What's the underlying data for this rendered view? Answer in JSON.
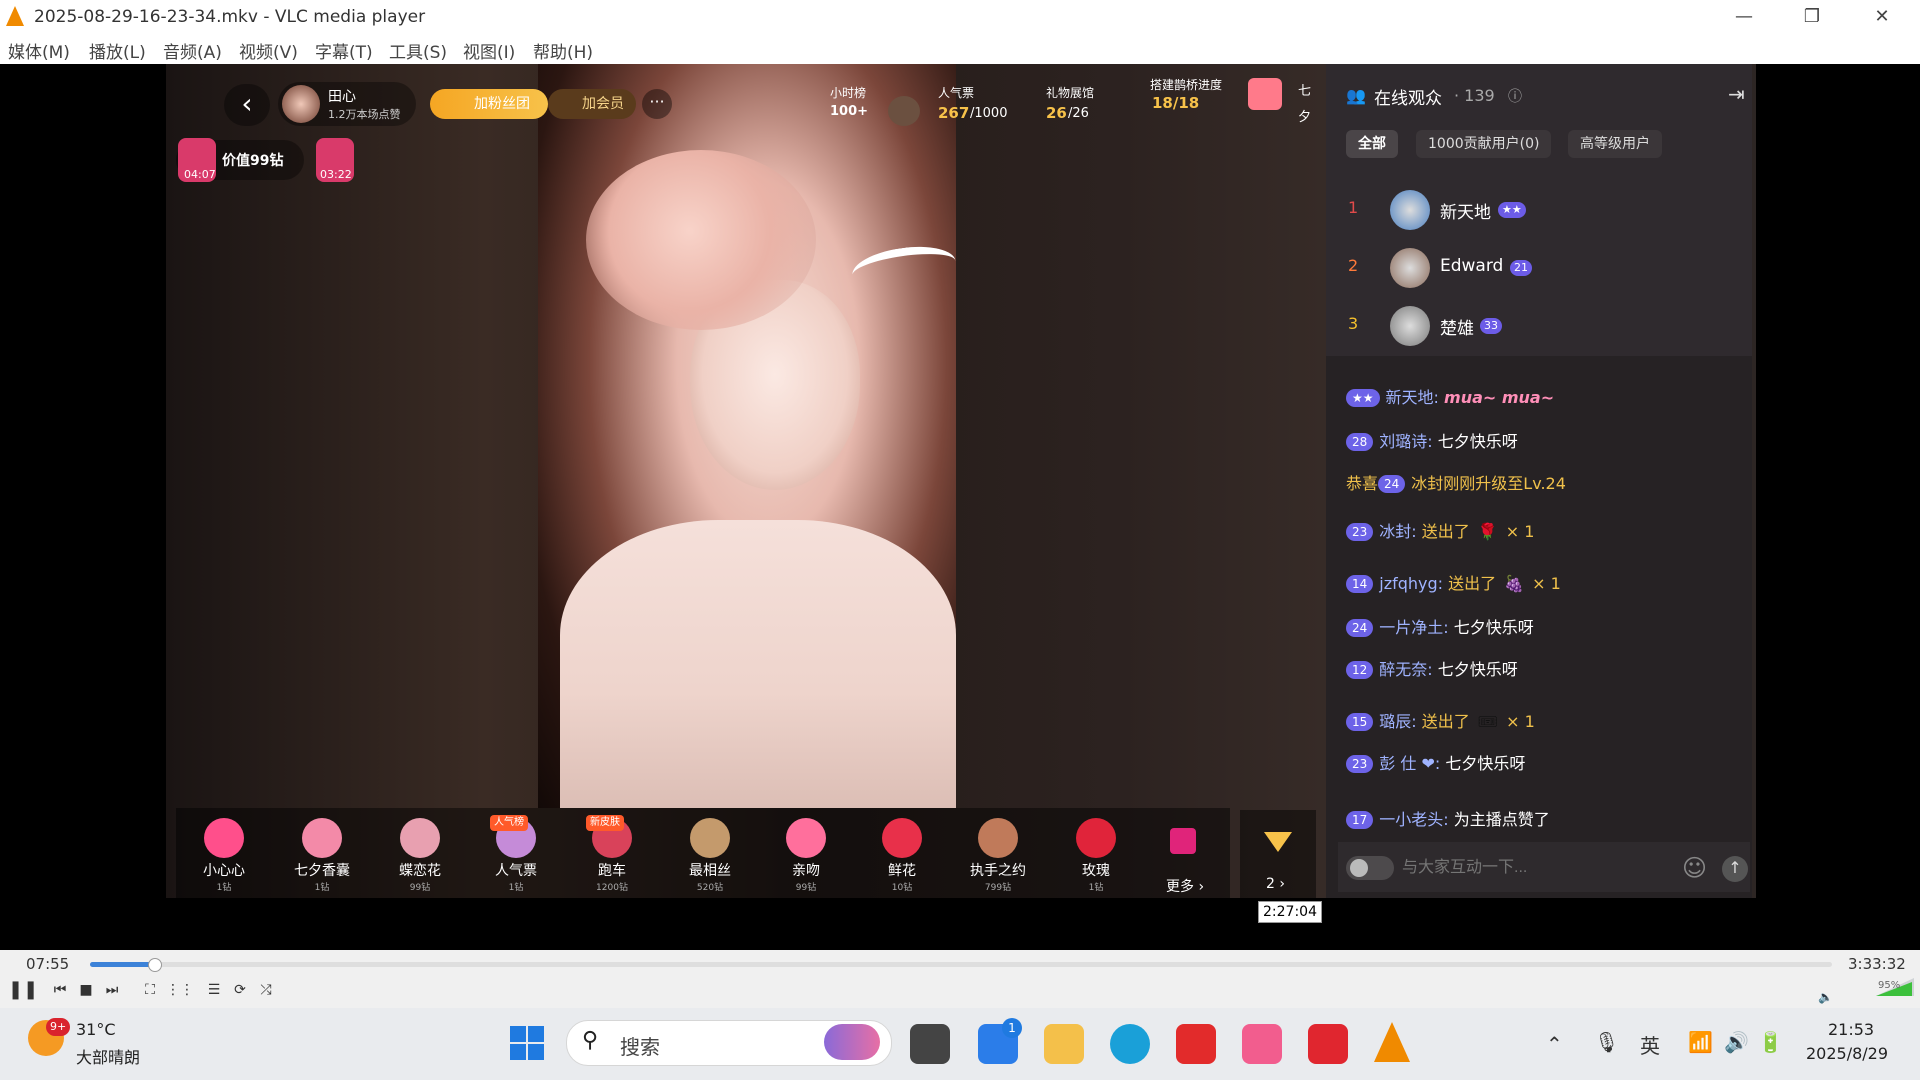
{
  "window": {
    "title": "2025-08-29-16-23-34.mkv - VLC media player",
    "minimize": "—",
    "maximize": "❐",
    "close": "✕"
  },
  "menu": [
    "媒体(M)",
    "播放(L)",
    "音频(A)",
    "视频(V)",
    "字幕(T)",
    "工具(S)",
    "视图(I)",
    "帮助(H)"
  ],
  "stream": {
    "host_name": "田心",
    "host_likes": "1.2万本场点赞",
    "fan_button": "加粉丝团",
    "member_button": "加会员",
    "more": "···",
    "hour_rank_label": "小时榜",
    "hour_rank_value": "100+",
    "popularity_label": "人气票",
    "popularity_value": "267",
    "popularity_total": "/1000",
    "gift_hall_label": "礼物展馆",
    "gift_hall_value": "26",
    "gift_hall_total": "/26",
    "bridge_label": "搭建鹊桥进度",
    "bridge_value": "18/18",
    "qixi_1": "七",
    "qixi_2": "夕",
    "value_chip": "价值99钻",
    "timer_1": "04:07",
    "timer_2": "03:22"
  },
  "gifts": [
    {
      "name": "小心心",
      "price": "1钻",
      "color": "#ff4f8b"
    },
    {
      "name": "七夕香囊",
      "price": "1钻",
      "color": "#f38aa8"
    },
    {
      "name": "蝶恋花",
      "price": "99钻",
      "color": "#e8a0b0"
    },
    {
      "name": "人气票",
      "price": "1钻",
      "color": "#c58bd8",
      "tag": "人气榜"
    },
    {
      "name": "跑车",
      "price": "1200钻",
      "color": "#d9425a",
      "tag": "新皮肤"
    },
    {
      "name": "最相丝",
      "price": "520钻",
      "color": "#c49a6c"
    },
    {
      "name": "亲吻",
      "price": "99钻",
      "color": "#ff6f9c"
    },
    {
      "name": "鲜花",
      "price": "10钻",
      "color": "#e8304a"
    },
    {
      "name": "执手之约",
      "price": "799钻",
      "color": "#c07a5a"
    },
    {
      "name": "玫瑰",
      "price": "1钻",
      "color": "#e0243a"
    }
  ],
  "gift_more": "更多 ›",
  "diamond_count": "2 ›",
  "audience": {
    "title": "在线观众",
    "count": "· 139",
    "tabs": [
      "全部",
      "1000贡献用户(0)",
      "高等级用户"
    ],
    "ranking": [
      {
        "rank": "1",
        "name": "新天地",
        "badge": "★★",
        "rank_color": "#e14a4a",
        "avatar": "#4a7fc0"
      },
      {
        "rank": "2",
        "name": "Edward",
        "badge": "21",
        "rank_color": "#ff7a3a",
        "avatar": "#8a6a5a"
      },
      {
        "rank": "3",
        "name": "楚雄",
        "badge": "33",
        "rank_color": "#f5c02c",
        "avatar": "#7a7a7a"
      }
    ]
  },
  "chat": [
    {
      "level": "★★",
      "name": "新天地:",
      "text": "mua~ mua~"
    },
    {
      "level": "28",
      "name": "刘璐诗:",
      "text": "七夕快乐呀"
    },
    {
      "prefix": "恭喜",
      "level": "24",
      "text": "冰封刚刚升级至Lv.24"
    },
    {
      "level": "23",
      "name": "冰封:",
      "text": "送出了",
      "gift": "🌹",
      "count": "× 1"
    },
    {
      "level": "14",
      "name": "jzfqhyg:",
      "text": "送出了",
      "gift": "🍇",
      "count": "× 1"
    },
    {
      "level": "24",
      "name": "一片净土:",
      "text": "七夕快乐呀"
    },
    {
      "level": "12",
      "name": "醉无奈:",
      "text": "七夕快乐呀"
    },
    {
      "level": "15",
      "name": "璐辰:",
      "text": "送出了",
      "gift": "🎟",
      "count": "× 1"
    },
    {
      "level": "23",
      "name": "彭 仕 ❤:",
      "text": "七夕快乐呀"
    },
    {
      "level": "17",
      "name": "一小老头:",
      "text": "为主播点赞了"
    }
  ],
  "chat_input_placeholder": "与大家互动一下...",
  "player": {
    "tooltip": "2:27:04",
    "elapsed": "07:55",
    "total": "3:33:32",
    "progress_fraction": 0.037,
    "volume": "95%"
  },
  "taskbar": {
    "weather_temp": "31°C",
    "weather_desc": "大部晴朗",
    "notif_badge": "9+",
    "search": "搜索",
    "store_badge": "1",
    "lang": "英",
    "time": "21:53",
    "date": "2025/8/29"
  }
}
